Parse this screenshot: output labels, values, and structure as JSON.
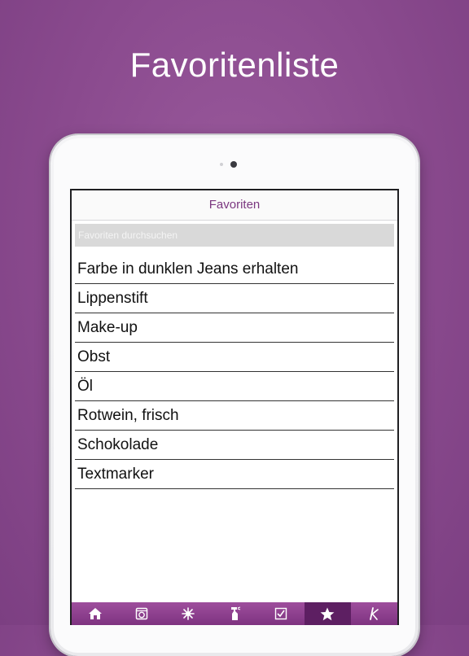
{
  "headline": "Favoritenliste",
  "navbar": {
    "title": "Favoriten"
  },
  "search": {
    "placeholder": "Favoriten durchsuchen"
  },
  "favorites": [
    "Farbe in dunklen Jeans erhalten",
    "Lippenstift",
    "Make-up",
    "Obst",
    "Öl",
    "Rotwein, frisch",
    "Schokolade",
    "Textmarker"
  ],
  "tabbar": {
    "tabs": [
      {
        "icon": "home-icon"
      },
      {
        "icon": "washing-machine-icon"
      },
      {
        "icon": "stain-splash-icon"
      },
      {
        "icon": "spray-bottle-icon"
      },
      {
        "icon": "checklist-icon"
      },
      {
        "icon": "star-icon",
        "active": true
      },
      {
        "icon": "k-logo-icon"
      }
    ]
  },
  "colors": {
    "background": "#8a4a8e",
    "accent": "#7b3780",
    "tab_active": "#5d1f62"
  }
}
